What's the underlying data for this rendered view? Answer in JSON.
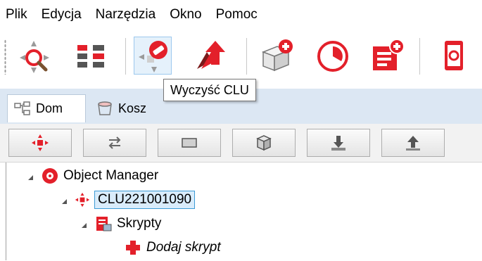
{
  "menu": {
    "items": [
      "Plik",
      "Edycja",
      "Narzędzia",
      "Okno",
      "Pomoc"
    ]
  },
  "toolbar": {
    "buttons": [
      {
        "icon": "search-network-icon"
      },
      {
        "icon": "modules-icon"
      },
      {
        "icon": "clear-clu-icon",
        "selected": true
      },
      {
        "icon": "upload-config-icon"
      },
      {
        "icon": "add-object-icon"
      },
      {
        "icon": "clock-icon"
      },
      {
        "icon": "add-document-icon"
      },
      {
        "icon": "device-icon"
      }
    ],
    "tooltip": "Wyczyść CLU"
  },
  "tabs": [
    {
      "label": "Dom",
      "icon": "house-tree-icon",
      "active": true
    },
    {
      "label": "Kosz",
      "icon": "trash-icon",
      "active": false
    }
  ],
  "subtoolbar": {
    "buttons": [
      {
        "icon": "clu-icon"
      },
      {
        "icon": "swap-arrows-icon"
      },
      {
        "icon": "rectangle-icon"
      },
      {
        "icon": "cube-icon"
      },
      {
        "icon": "download-icon"
      },
      {
        "icon": "upload-icon"
      }
    ]
  },
  "tree": {
    "root": {
      "label": "Object Manager"
    },
    "clu": {
      "label": "CLU221001090"
    },
    "scripts": {
      "label": "Skrypty"
    },
    "add_script": {
      "label": "Dodaj skrypt"
    }
  },
  "colors": {
    "accent_red": "#e3202a",
    "tab_strip": "#dce7f3",
    "selection_border": "#3c9bd6"
  }
}
